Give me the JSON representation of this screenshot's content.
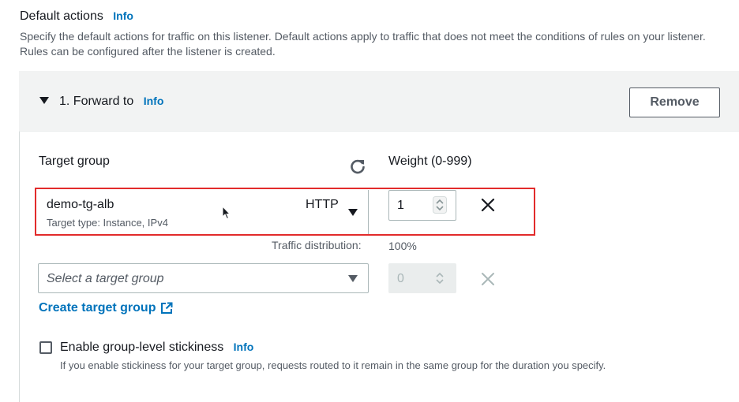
{
  "section": {
    "title": "Default actions",
    "info": "Info",
    "description": "Specify the default actions for traffic on this listener. Default actions apply to traffic that does not meet the conditions of rules on your listener. Rules can be configured after the listener is created."
  },
  "action": {
    "title": "1. Forward to",
    "info": "Info",
    "remove_label": "Remove"
  },
  "labels": {
    "target_group": "Target group",
    "weight": "Weight (0-999)",
    "traffic_distribution": "Traffic distribution:"
  },
  "target_groups": [
    {
      "name": "demo-tg-alb",
      "type": "Target type: Instance, IPv4",
      "protocol": "HTTP",
      "weight": "1",
      "distribution": "100%"
    }
  ],
  "empty_row": {
    "placeholder": "Select a target group",
    "weight": "0"
  },
  "create_link": "Create target group",
  "stickiness": {
    "label": "Enable group-level stickiness",
    "info": "Info",
    "description": "If you enable stickiness for your target group, requests routed to it remain in the same group for the duration you specify.",
    "checked": false
  },
  "colors": {
    "link": "#0073bb",
    "highlight": "#e22b2b"
  }
}
